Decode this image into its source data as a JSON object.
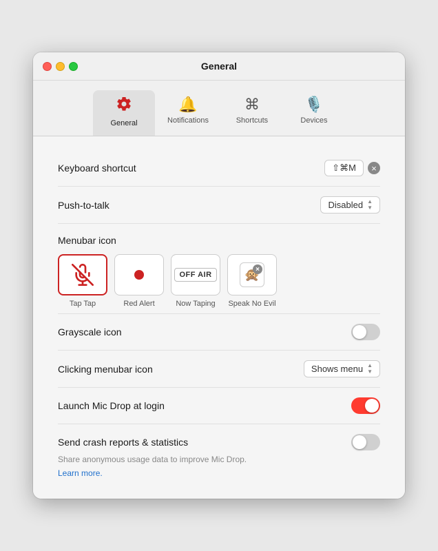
{
  "window": {
    "title": "General"
  },
  "tabs": [
    {
      "id": "general",
      "label": "General",
      "icon": "gear",
      "active": true
    },
    {
      "id": "notifications",
      "label": "Notifications",
      "icon": "bell",
      "active": false
    },
    {
      "id": "shortcuts",
      "label": "Shortcuts",
      "icon": "command",
      "active": false
    },
    {
      "id": "devices",
      "label": "Devices",
      "icon": "mic",
      "active": false
    }
  ],
  "keyboard_shortcut": {
    "label": "Keyboard shortcut",
    "value": "⇧⌘M"
  },
  "push_to_talk": {
    "label": "Push-to-talk",
    "value": "Disabled"
  },
  "menubar_icon": {
    "section_label": "Menubar icon",
    "options": [
      {
        "id": "tap-tap",
        "label": "Tap Tap",
        "selected": true
      },
      {
        "id": "red-alert",
        "label": "Red Alert",
        "selected": false
      },
      {
        "id": "now-taping",
        "label": "Now Taping",
        "selected": false
      },
      {
        "id": "speak-no-evil",
        "label": "Speak No Evil",
        "selected": false
      }
    ]
  },
  "grayscale_icon": {
    "label": "Grayscale icon",
    "enabled": false
  },
  "clicking_menubar": {
    "label": "Clicking menubar icon",
    "value": "Shows menu"
  },
  "launch_at_login": {
    "label": "Launch Mic Drop at login",
    "enabled": true
  },
  "crash_reports": {
    "label": "Send crash reports & statistics",
    "description": "Share anonymous usage data to improve Mic Drop.",
    "learn_more": "Learn more.",
    "enabled": false
  }
}
